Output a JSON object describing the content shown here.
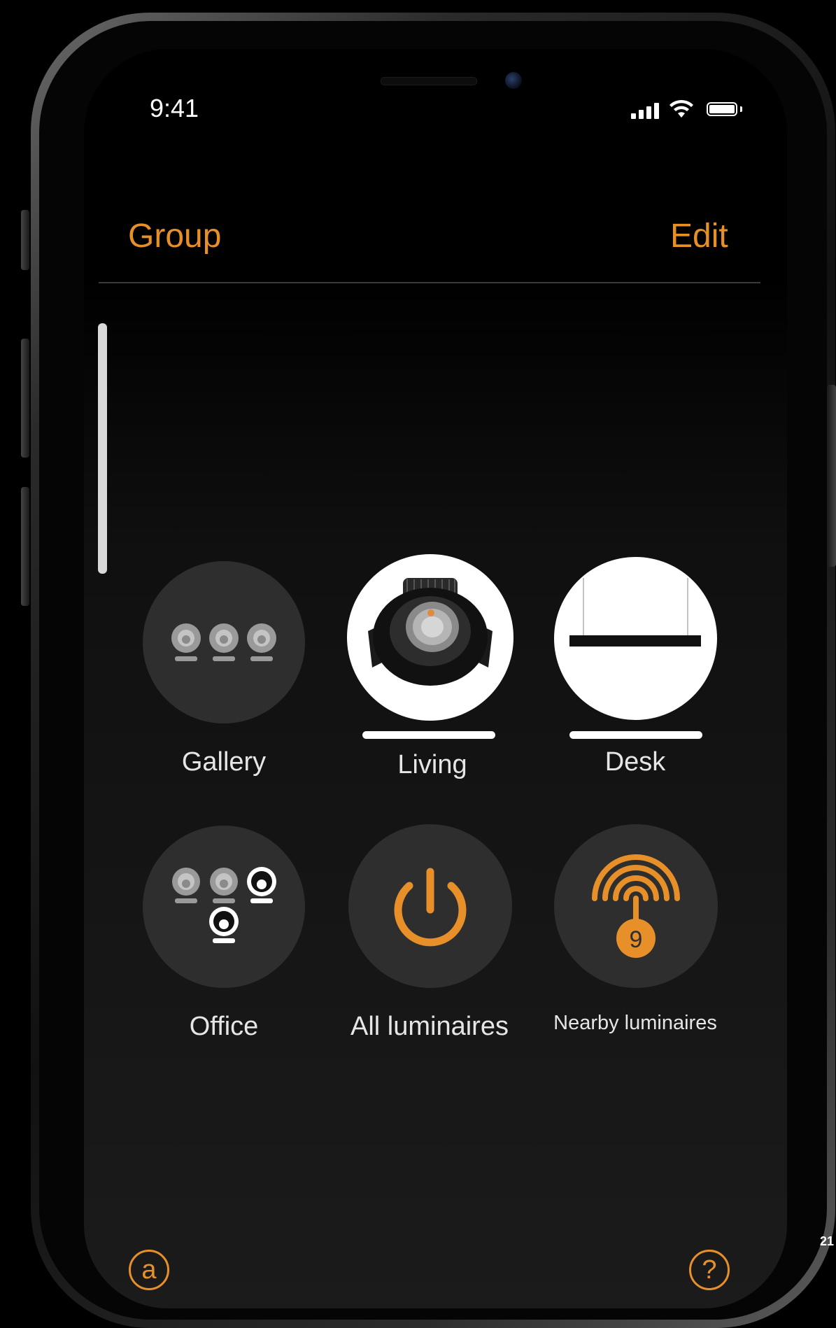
{
  "status_bar": {
    "time": "9:41",
    "icons": [
      "signal-icon",
      "wifi-icon",
      "battery-icon"
    ]
  },
  "nav": {
    "left_label": "Group",
    "right_label": "Edit"
  },
  "groups": [
    {
      "label": "Gallery",
      "icon": "three-spotlights-icon",
      "active": false
    },
    {
      "label": "Living",
      "icon": "downlight-image",
      "active": true
    },
    {
      "label": "Desk",
      "icon": "linear-pendant-image",
      "active": true
    },
    {
      "label": "Office",
      "icon": "four-spotlights-icon",
      "active": false
    },
    {
      "label": "All luminaires",
      "icon": "power-icon",
      "active": false
    },
    {
      "label": "Nearby luminaires",
      "icon": "nearby-signal-icon",
      "active": false,
      "badge": "9"
    }
  ],
  "bottom": {
    "left_icon_glyph": "a",
    "right_icon_glyph": "?"
  },
  "page_number": "21",
  "colors": {
    "accent": "#e7902a",
    "tile_bg": "#2e2e2e",
    "label": "#e6e6e6"
  }
}
